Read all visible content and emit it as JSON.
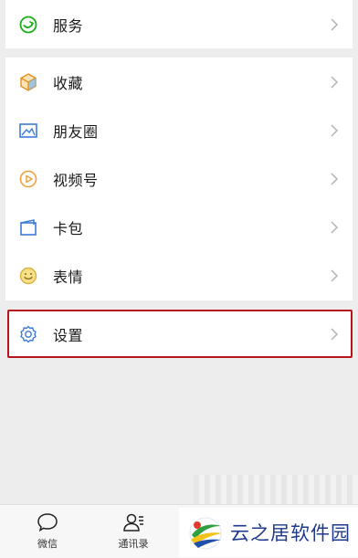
{
  "top_item": {
    "label": "服务"
  },
  "menu_items": [
    {
      "label": "收藏",
      "icon": "favorites-cube-icon"
    },
    {
      "label": "朋友圈",
      "icon": "moments-picture-icon"
    },
    {
      "label": "视频号",
      "icon": "channels-play-icon"
    },
    {
      "label": "卡包",
      "icon": "card-wallet-icon"
    },
    {
      "label": "表情",
      "icon": "sticker-smile-icon"
    }
  ],
  "settings_item": {
    "label": "设置",
    "icon": "gear-icon"
  },
  "tabbar": {
    "tabs": [
      {
        "label": "微信",
        "icon": "chat-bubble-icon"
      },
      {
        "label": "通讯录",
        "icon": "contacts-icon"
      }
    ]
  },
  "watermark": {
    "text": "云之居软件园"
  },
  "colors": {
    "highlight_border": "#b5161c",
    "icon_green": "#1aad19",
    "icon_orange": "#f2a13a",
    "icon_blue": "#3c7bd8"
  }
}
